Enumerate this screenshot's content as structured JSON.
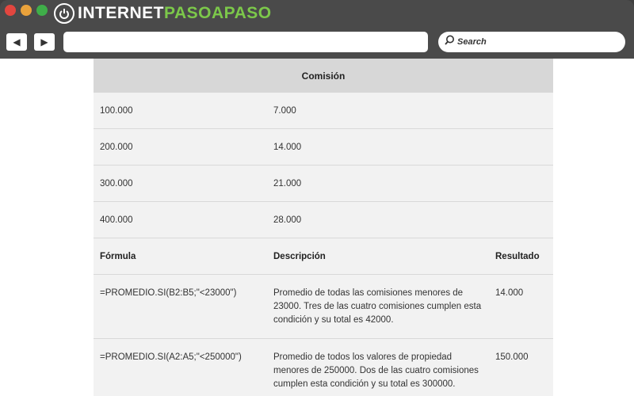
{
  "browser": {
    "logo": {
      "part_a": "INTERNET",
      "part_b": "PASOAPASO",
      "accent_color": "#7cc84a"
    },
    "nav": {
      "back_glyph": "◀",
      "forward_glyph": "▶"
    },
    "address": "",
    "search_label": "Search"
  },
  "table1": {
    "header": "Comisión",
    "rows": [
      {
        "value": "100.000",
        "commission": "7.000"
      },
      {
        "value": "200.000",
        "commission": "14.000"
      },
      {
        "value": "300.000",
        "commission": "21.000"
      },
      {
        "value": "400.000",
        "commission": "28.000"
      }
    ]
  },
  "table2": {
    "headers": {
      "formula": "Fórmula",
      "description": "Descripción",
      "result": "Resultado"
    },
    "rows": [
      {
        "formula": "=PROMEDIO.SI(B2:B5;\"<23000\")",
        "description": "Promedio de todas las comisiones menores de 23000. Tres de las cuatro comisiones cumplen esta condición y su total es 42000.",
        "result": "14.000"
      },
      {
        "formula": "=PROMEDIO.SI(A2:A5;\"<250000\")",
        "description": "Promedio de todos los valores de propiedad menores de 250000. Dos de las cuatro comisiones cumplen esta condición y su total es 300000.",
        "result": "150.000"
      }
    ]
  }
}
